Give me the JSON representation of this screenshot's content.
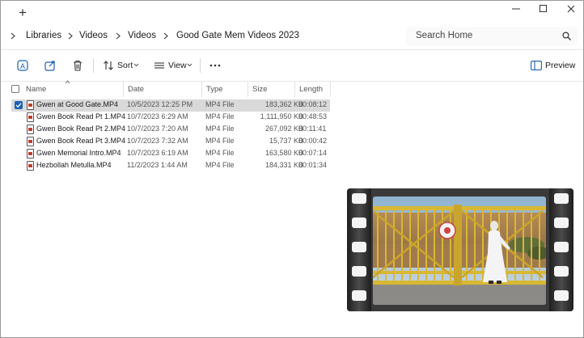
{
  "window": {
    "new_tab_symbol": "+"
  },
  "breadcrumb": {
    "items": [
      "Libraries",
      "Videos",
      "Videos",
      "Good Gate Mem Videos 2023"
    ]
  },
  "search": {
    "placeholder": "Search Home"
  },
  "toolbar": {
    "sort_label": "Sort",
    "view_label": "View",
    "preview_label": "Preview"
  },
  "columns": {
    "name": "Name",
    "date": "Date",
    "type": "Type",
    "size": "Size",
    "length": "Length"
  },
  "files": [
    {
      "name": "Gwen at Good Gate.MP4",
      "date": "10/5/2023 12:25 PM",
      "type": "MP4 File",
      "size": "183,362 KB",
      "length": "00:08:12",
      "selected": true
    },
    {
      "name": "Gwen Book Read Pt 1.MP4",
      "date": "10/7/2023 6:29 AM",
      "type": "MP4 File",
      "size": "1,111,950 KB",
      "length": "00:48:53",
      "selected": false
    },
    {
      "name": "Gwen Book Read Pt 2.MP4",
      "date": "10/7/2023 7:20 AM",
      "type": "MP4 File",
      "size": "267,092 KB",
      "length": "00:11:41",
      "selected": false
    },
    {
      "name": "Gwen Book Read Pt 3.MP4",
      "date": "10/7/2023 7:32 AM",
      "type": "MP4 File",
      "size": "15,737 KB",
      "length": "00:00:42",
      "selected": false
    },
    {
      "name": "Gwen Memorial Intro.MP4",
      "date": "10/7/2023 6:19 AM",
      "type": "MP4 File",
      "size": "163,580 KB",
      "length": "00:07:14",
      "selected": false
    },
    {
      "name": "Hezbollah Metulla.MP4",
      "date": "11/2/2023 1:44 AM",
      "type": "MP4 File",
      "size": "184,331 KB",
      "length": "00:01:34",
      "selected": false
    }
  ],
  "colors": {
    "selection_bg": "#d9d9d9",
    "checkbox_accent": "#1a5fb4",
    "gate_yellow": "#d8b833",
    "file_icon_red": "#c0392b"
  },
  "icons": {
    "toolbar": [
      "ai-rename-icon",
      "share-icon",
      "delete-icon",
      "sort-icon",
      "view-icon",
      "more-icon",
      "preview-pane-icon"
    ]
  }
}
